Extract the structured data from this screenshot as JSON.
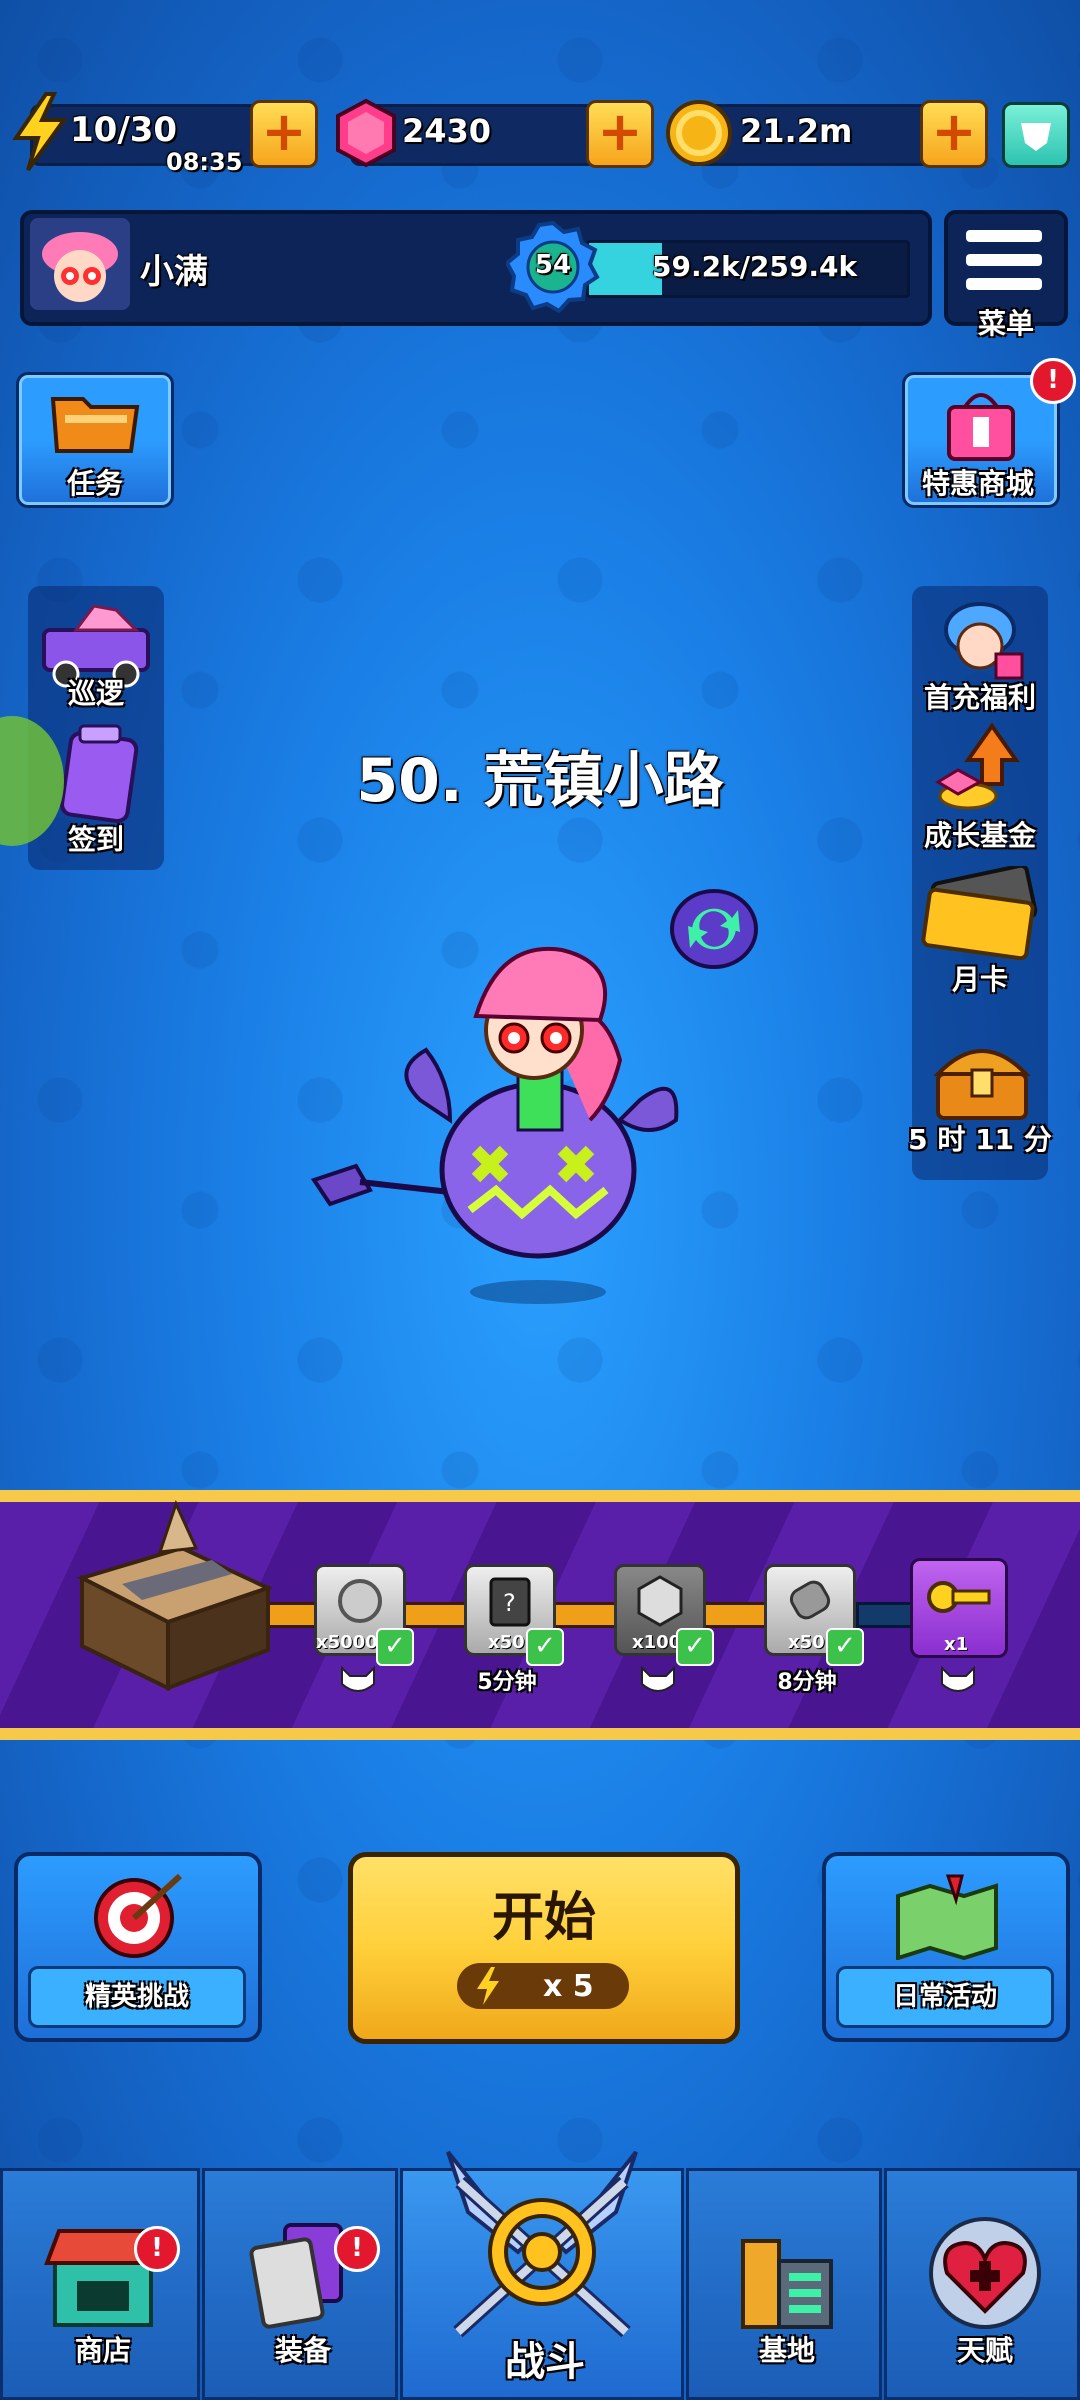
{
  "resources": {
    "energy": {
      "value": "10/30",
      "timer": "08:35",
      "icon": "lightning-icon"
    },
    "gems": {
      "value": "2430",
      "icon": "gem-icon"
    },
    "coins": {
      "value": "21.2m",
      "icon": "coin-icon"
    }
  },
  "player": {
    "name": "小满",
    "level": "54",
    "exp": "59.2k/259.4k",
    "exp_progress": 0.228
  },
  "menu": {
    "label": "菜单"
  },
  "left_buttons": {
    "tasks": "任务",
    "patrol": "巡逻",
    "signin": "签到"
  },
  "right_buttons": {
    "shop": "特惠商城",
    "first_recharge": "首充福利",
    "growth_fund": "成长基金",
    "monthly_card": "月卡",
    "chest_timer": "5 时 11 分"
  },
  "stage": {
    "title": "50. 荒镇小路"
  },
  "rewards": [
    {
      "qty": "x5000",
      "time": ""
    },
    {
      "qty": "x50",
      "time": "5分钟"
    },
    {
      "qty": "x100",
      "time": ""
    },
    {
      "qty": "x50",
      "time": "8分钟"
    },
    {
      "qty": "x1",
      "time": ""
    }
  ],
  "actions": {
    "elite": "精英挑战",
    "start": "开始",
    "cost": "x 5",
    "daily": "日常活动"
  },
  "nav": {
    "shop": "商店",
    "equip": "装备",
    "battle": "战斗",
    "base": "基地",
    "talent": "天赋"
  },
  "colors": {
    "accent": "#f6c94a",
    "badge": "#e3172d",
    "exp_bar": "#35d3e0"
  }
}
